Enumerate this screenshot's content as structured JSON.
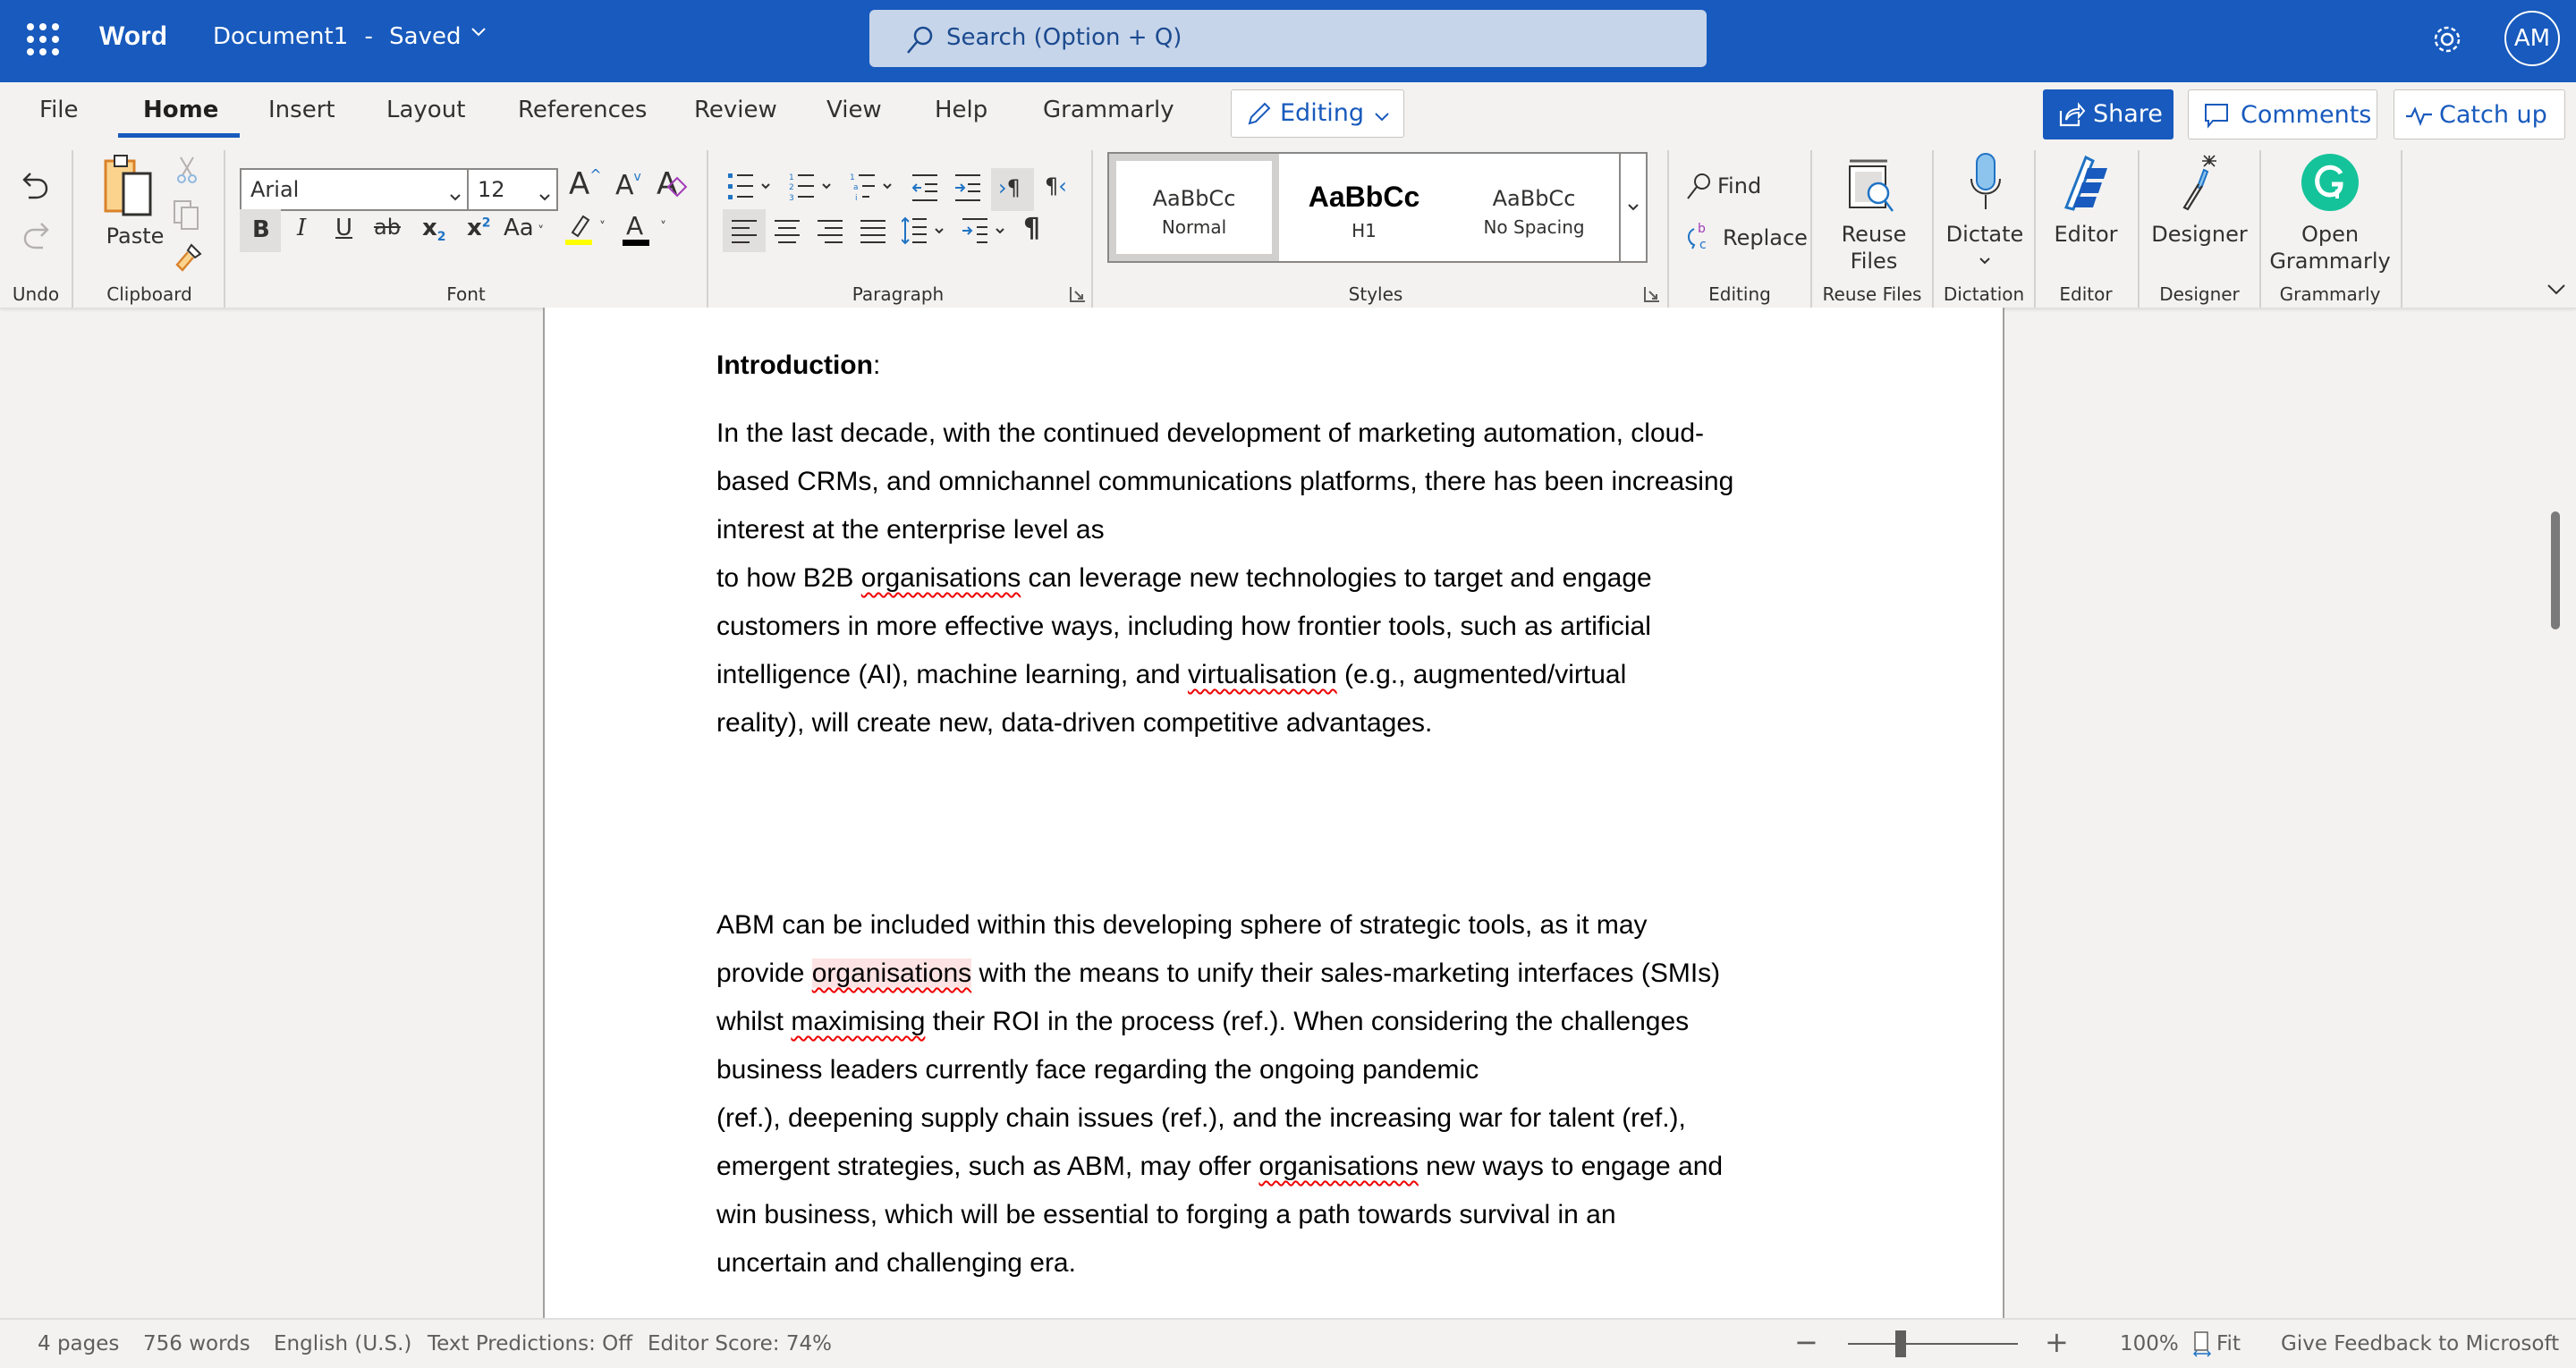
{
  "titlebar": {
    "app_name": "Word",
    "document_title": "Document1",
    "separator": "-",
    "save_status": "Saved",
    "search_placeholder": "Search (Option + Q)",
    "avatar_initials": "AM",
    "colors": {
      "brand": "#185ABD",
      "search_bg": "#C7D5EA"
    }
  },
  "tabs": [
    {
      "label": "File",
      "active": false
    },
    {
      "label": "Home",
      "active": true
    },
    {
      "label": "Insert",
      "active": false
    },
    {
      "label": "Layout",
      "active": false
    },
    {
      "label": "References",
      "active": false
    },
    {
      "label": "Review",
      "active": false
    },
    {
      "label": "View",
      "active": false
    },
    {
      "label": "Help",
      "active": false
    },
    {
      "label": "Grammarly",
      "active": false
    }
  ],
  "mode_button": {
    "label": "Editing",
    "icon": "pencil-icon"
  },
  "actions": {
    "share": {
      "label": "Share",
      "icon": "share-icon"
    },
    "comments": {
      "label": "Comments",
      "icon": "comment-icon"
    },
    "catch_up": {
      "label": "Catch up",
      "icon": "pulse-icon"
    }
  },
  "ribbon": {
    "groups": {
      "undo": "Undo",
      "clipboard": "Clipboard",
      "font": "Font",
      "paragraph": "Paragraph",
      "styles": "Styles",
      "editing": "Editing",
      "reuse_files": "Reuse Files",
      "dictation": "Dictation",
      "editor": "Editor",
      "designer": "Designer",
      "grammarly": "Grammarly"
    },
    "clipboard": {
      "paste_label": "Paste"
    },
    "font": {
      "family": "Arial",
      "size": "12",
      "bold": "B",
      "italic": "I",
      "underline": "U",
      "strikethrough": "ab",
      "subscript": "x",
      "superscript": "x",
      "change_case": "Aa",
      "font_color": "A",
      "grow": "A",
      "shrink": "A",
      "clear": "A",
      "highlight_color": "#FFFF00",
      "text_color": "#000000"
    },
    "styles": [
      {
        "preview": "AaBbCc",
        "name": "Normal",
        "selected": true
      },
      {
        "preview": "AaBbCc",
        "name": "H1",
        "selected": false
      },
      {
        "preview": "AaBbCc",
        "name": "No Spacing",
        "selected": false
      }
    ],
    "editing": {
      "find": "Find",
      "replace": "Replace"
    },
    "reuse_files": {
      "line1": "Reuse",
      "line2": "Files"
    },
    "dictate": {
      "label": "Dictate"
    },
    "editor": {
      "label": "Editor"
    },
    "designer": {
      "label": "Designer"
    },
    "grammarly": {
      "line1": "Open",
      "line2": "Grammarly",
      "color": "#15C39A"
    }
  },
  "document": {
    "heading": "Introduction",
    "heading_suffix": ":",
    "paragraph1": [
      [
        {
          "t": "In the last decade, with the continued development of marketing automation, cloud-"
        }
      ],
      [
        {
          "t": "based CRMs, and omnichannel communications platforms, there has been increasing"
        }
      ],
      [
        {
          "t": "interest at the enterprise level as"
        }
      ],
      [
        {
          "t": "to how B2B "
        },
        {
          "t": "organisations",
          "spell": true
        },
        {
          "t": " can leverage new technologies to target and engage"
        }
      ],
      [
        {
          "t": "customers in more effective ways, including how frontier tools, such as artificial"
        }
      ],
      [
        {
          "t": "intelligence (AI), machine learning, and "
        },
        {
          "t": "virtualisation",
          "spell": true
        },
        {
          "t": " (e.g., augmented/virtual"
        }
      ],
      [
        {
          "t": "reality), will create new, data-driven competitive advantages."
        }
      ]
    ],
    "paragraph2": [
      [
        {
          "t": "ABM can be included within this developing sphere of strategic tools, as it may"
        }
      ],
      [
        {
          "t": "provide "
        },
        {
          "t": "organisations",
          "spell": true,
          "highlight": true
        },
        {
          "t": " with the means to unify their sales-marketing interfaces (SMIs)"
        }
      ],
      [
        {
          "t": "whilst "
        },
        {
          "t": "maximising",
          "spell": true
        },
        {
          "t": " their ROI in the process (ref.). When considering the challenges"
        }
      ],
      [
        {
          "t": "business leaders currently face regarding the ongoing pandemic"
        }
      ],
      [
        {
          "t": "(ref.), deepening supply chain issues (ref.), and the increasing war for talent (ref.),"
        }
      ],
      [
        {
          "t": "emergent strategies, such as ABM, may offer "
        },
        {
          "t": "organisations",
          "spell": true
        },
        {
          "t": " new ways to engage and"
        }
      ],
      [
        {
          "t": "win business, which will be essential to forging a path towards survival in an"
        }
      ],
      [
        {
          "t": "uncertain and challenging era."
        }
      ]
    ]
  },
  "statusbar": {
    "pages": "4 pages",
    "words": "756 words",
    "language": "English (U.S.)",
    "text_predictions": "Text Predictions: Off",
    "editor_score": "Editor Score: 74%",
    "zoom_out": "−",
    "zoom_in": "+",
    "zoom_level": "100%",
    "zoom_fraction": 0.3,
    "fit": "Fit",
    "feedback": "Give Feedback to Microsoft"
  }
}
